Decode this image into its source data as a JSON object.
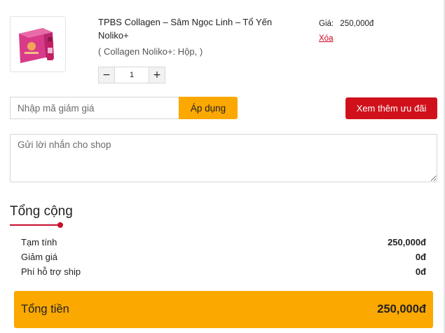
{
  "product": {
    "name": "TPBS Collagen – Sâm Ngọc Linh – Tổ Yến Noliko+",
    "variant": "( Collagen Noliko+: Hộp, )",
    "image_icon": "collagen-product-box-image",
    "quantity": "1",
    "minus_label": "−",
    "plus_label": "+",
    "price_label": "Giá:",
    "price_value": "250,000đ",
    "delete_label": "Xóa"
  },
  "coupon": {
    "placeholder": "Nhập mã giảm giá",
    "apply_label": "Áp dụng",
    "more_offers_label": "Xem thêm ưu đãi"
  },
  "note": {
    "placeholder": "Gửi lời nhắn cho shop"
  },
  "summary": {
    "title": "Tổng cộng",
    "rows": [
      {
        "label": "Tạm tính",
        "value": "250,000đ"
      },
      {
        "label": "Giảm giá",
        "value": "0đ"
      },
      {
        "label": "Phí hỗ trợ ship",
        "value": "0đ"
      }
    ],
    "total_label": "Tổng tiền",
    "total_value": "250,000đ"
  },
  "colors": {
    "accent_orange": "#fba800",
    "accent_red": "#d0111b",
    "title_underline": "#c7102e"
  }
}
